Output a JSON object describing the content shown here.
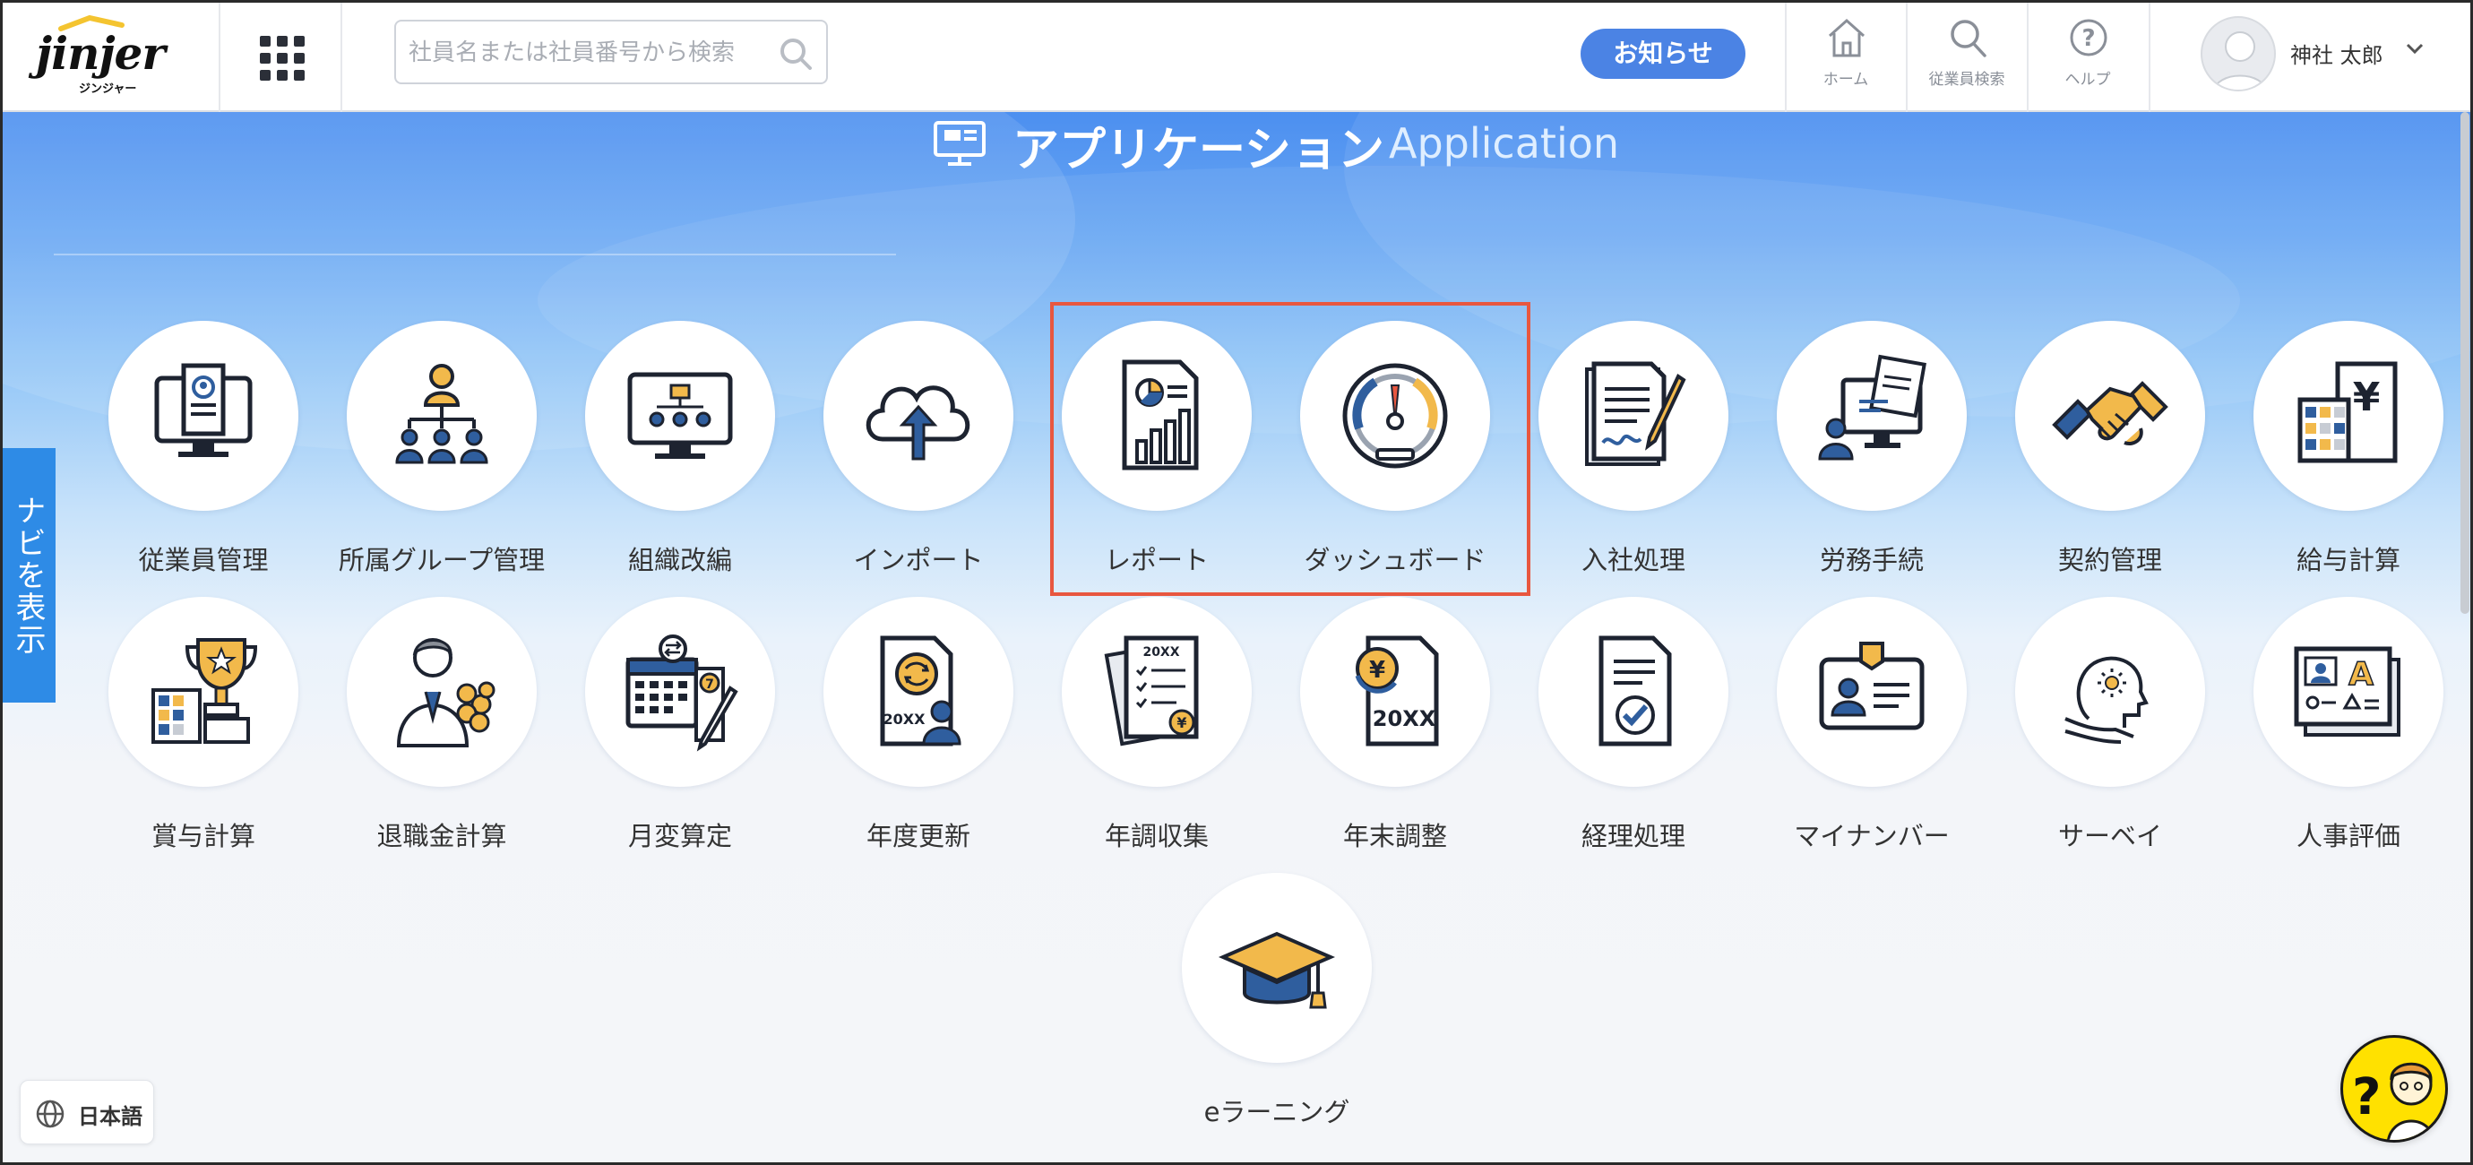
{
  "header": {
    "logo_text": "jinjer",
    "logo_sub": "ジンジャー",
    "search_placeholder": "社員名または社員番号から検索",
    "notice_label": "お知らせ",
    "nav": [
      {
        "label": "ホーム",
        "icon": "home-icon"
      },
      {
        "label": "従業員検索",
        "icon": "search-icon"
      },
      {
        "label": "ヘルプ",
        "icon": "help-icon"
      }
    ],
    "user_name": "神社 太郎"
  },
  "section": {
    "title_jp": "アプリケーション",
    "title_en": "Application"
  },
  "side_tab": {
    "label": "ナビを表示"
  },
  "apps_row1": [
    {
      "label": "従業員管理",
      "icon": "employee-management-icon"
    },
    {
      "label": "所属グループ管理",
      "icon": "org-group-icon"
    },
    {
      "label": "組織改編",
      "icon": "reorganization-icon"
    },
    {
      "label": "インポート",
      "icon": "cloud-upload-icon"
    },
    {
      "label": "レポート",
      "icon": "report-icon"
    },
    {
      "label": "ダッシュボード",
      "icon": "dashboard-gauge-icon"
    },
    {
      "label": "入社処理",
      "icon": "contract-sign-icon"
    },
    {
      "label": "労務手続",
      "icon": "labor-procedures-icon"
    },
    {
      "label": "契約管理",
      "icon": "handshake-icon"
    },
    {
      "label": "給与計算",
      "icon": "payroll-calculator-icon"
    }
  ],
  "apps_row2": [
    {
      "label": "賞与計算",
      "icon": "bonus-trophy-icon"
    },
    {
      "label": "退職金計算",
      "icon": "retirement-bouquet-icon"
    },
    {
      "label": "月変算定",
      "icon": "calendar-edit-icon"
    },
    {
      "label": "年度更新",
      "icon": "annual-renewal-icon"
    },
    {
      "label": "年調収集",
      "icon": "year-end-collection-icon"
    },
    {
      "label": "年末調整",
      "icon": "year-end-adjustment-icon"
    },
    {
      "label": "経理処理",
      "icon": "accounting-check-icon"
    },
    {
      "label": "マイナンバー",
      "icon": "id-card-icon"
    },
    {
      "label": "サーベイ",
      "icon": "survey-head-icon"
    },
    {
      "label": "人事評価",
      "icon": "hr-evaluation-icon"
    }
  ],
  "apps_row3": [
    {
      "label": "eラーニング",
      "icon": "graduation-cap-icon"
    }
  ],
  "footer": {
    "language_label": "日本語"
  },
  "colors": {
    "brand_blue": "#4b83e4",
    "highlight": "#e8573f",
    "navi_tab": "#2e8be6",
    "help_bot": "#ffe100"
  }
}
